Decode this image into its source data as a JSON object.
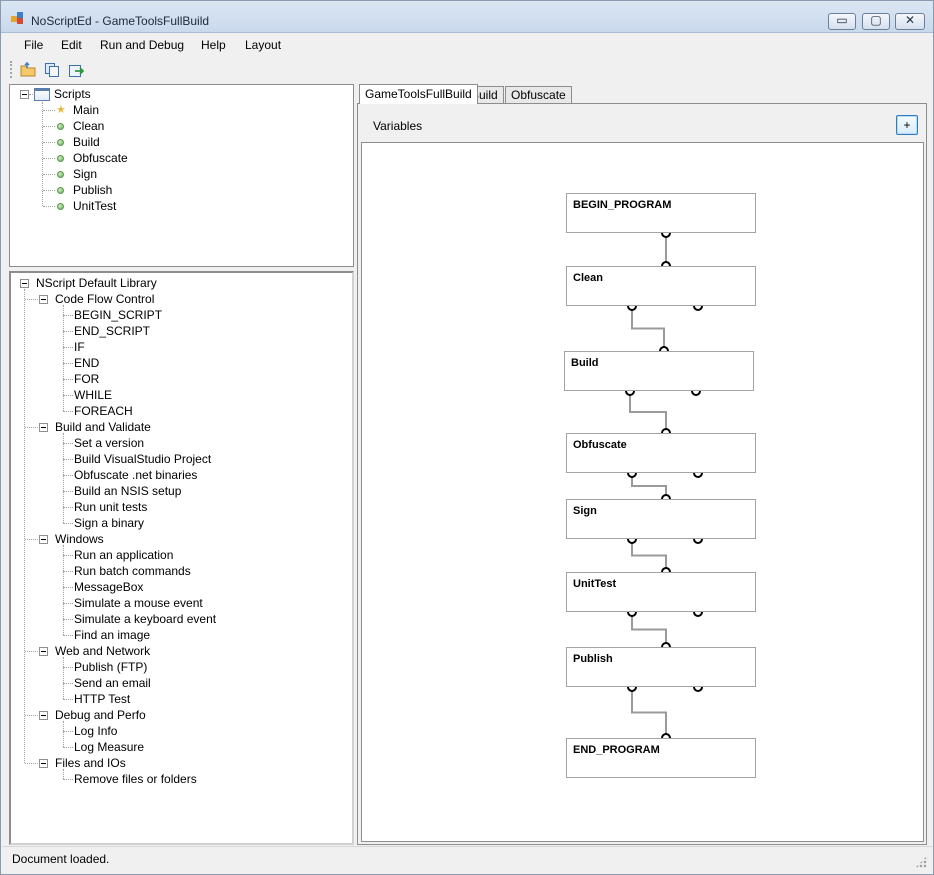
{
  "window": {
    "title": "NoScriptEd - GameToolsFullBuild",
    "controls": {
      "minimize": "▭",
      "maximize": "▢",
      "close": "✕"
    }
  },
  "menu": [
    "File",
    "Edit",
    "Run and Debug",
    "Help",
    "Layout"
  ],
  "toolbar": {
    "icons": [
      "open-folder-icon",
      "copy-icon",
      "export-icon"
    ]
  },
  "scripts_tree": {
    "root": "Scripts",
    "items": [
      {
        "label": "Main",
        "icon": "star-icon"
      },
      {
        "label": "Clean",
        "icon": "bullet-icon"
      },
      {
        "label": "Build",
        "icon": "bullet-icon"
      },
      {
        "label": "Obfuscate",
        "icon": "bullet-icon"
      },
      {
        "label": "Sign",
        "icon": "bullet-icon"
      },
      {
        "label": "Publish",
        "icon": "bullet-icon"
      },
      {
        "label": "UnitTest",
        "icon": "bullet-icon"
      }
    ]
  },
  "library_tree": {
    "root": "NScript Default Library",
    "groups": [
      {
        "label": "Code Flow Control",
        "items": [
          "BEGIN_SCRIPT",
          "END_SCRIPT",
          "IF",
          "END",
          "FOR",
          "WHILE",
          "FOREACH"
        ]
      },
      {
        "label": "Build and Validate",
        "items": [
          "Set a version",
          "Build VisualStudio Project",
          "Obfuscate .net binaries",
          "Build an NSIS setup",
          "Run unit tests",
          "Sign a binary"
        ]
      },
      {
        "label": "Windows",
        "items": [
          "Run an application",
          "Run batch commands",
          "MessageBox",
          "Simulate a mouse event",
          "Simulate a keyboard event",
          "Find an image"
        ]
      },
      {
        "label": "Web and Network",
        "items": [
          "Publish (FTP)",
          "Send an email",
          "HTTP Test"
        ]
      },
      {
        "label": "Debug and Perfo",
        "items": [
          "Log Info",
          "Log Measure"
        ]
      },
      {
        "label": "Files and IOs",
        "items": [
          "Remove files or folders"
        ]
      }
    ]
  },
  "tabs": [
    "GameToolsFullBuild",
    "Build",
    "Obfuscate"
  ],
  "active_tab": "GameToolsFullBuild",
  "variables_label": "Variables",
  "add_button_label": "+",
  "flow_nodes": [
    "BEGIN_PROGRAM",
    "Clean",
    "Build",
    "Obfuscate",
    "Sign",
    "UnitTest",
    "Publish",
    "END_PROGRAM"
  ],
  "status": "Document loaded."
}
